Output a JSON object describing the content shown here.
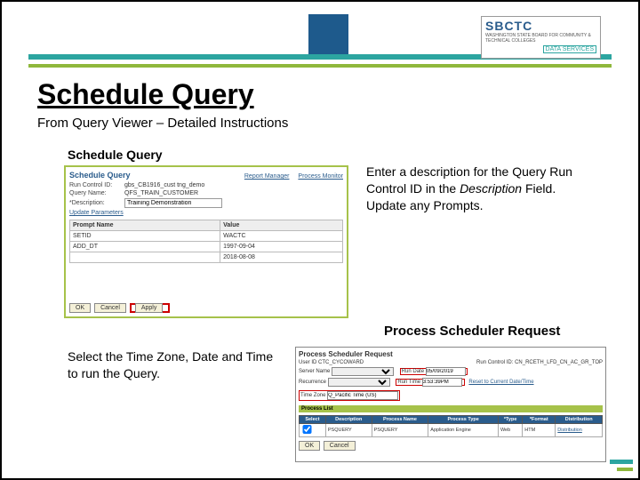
{
  "logo": {
    "name": "SBCTC",
    "sub": "WASHINGTON STATE BOARD FOR COMMUNITY & TECHNICAL COLLEGES",
    "ds": "DATA SERVICES"
  },
  "title": "Schedule Query",
  "subtitle": "From Query Viewer – Detailed Instructions",
  "section1_label": "Schedule Query",
  "sq": {
    "header": "Schedule Query",
    "run_ctrl_lbl": "Run Control ID:",
    "run_ctrl_val": "gbs_CB1916_cust tng_demo",
    "link_report": "Report Manager",
    "link_process": "Process Monitor",
    "qname_lbl": "Query Name:",
    "qname_val": "QFS_TRAIN_CUSTOMER",
    "desc_lbl": "*Description:",
    "desc_val": "Training Demonstration",
    "update_params": "Update Parameters",
    "th_prompt": "Prompt Name",
    "th_value": "Value",
    "rows": [
      {
        "p": "SETID",
        "v": "WACTC"
      },
      {
        "p": "ADD_DT",
        "v": "1997-09-04"
      },
      {
        "p": "",
        "v": "2018-08-08"
      }
    ],
    "btn_ok": "OK",
    "btn_cancel": "Cancel",
    "btn_apply": "Apply"
  },
  "instruction1_a": "Enter a description for the Query Run Control ID in the ",
  "instruction1_i": "Description",
  "instruction1_b": " Field. Update any Prompts.",
  "psr_label": "Process Scheduler Request",
  "instruction2": "Select the Time Zone, Date and Time to run the Query.",
  "psr": {
    "header": "Process Scheduler Request",
    "user_lbl": "User ID",
    "user_val": "CTC_CYCOWARD",
    "rc_lbl": "Run Control ID:",
    "rc_val": "CN_RCETH_LFD_CN_AC_GR_TOP",
    "server_lbl": "Server Name",
    "server_val": "",
    "rundate_lbl": "Run Date",
    "rundate_val": "05/09/2019",
    "recur_lbl": "Recurrence",
    "recur_val": "",
    "runtime_lbl": "Run Time",
    "runtime_val": "3:53:39PM",
    "reset_link": "Reset to Current Date/Time",
    "tz_lbl": "Time Zone",
    "tz_val": "Q_Pacific Time (US)",
    "plist": "Process List",
    "th": {
      "sel": "Select",
      "desc": "Description",
      "pname": "Process Name",
      "ptype": "Process Type",
      "type": "*Type",
      "fmt": "*Format",
      "dist": "Distribution"
    },
    "row": {
      "desc": "PSQUERY",
      "pname": "PSQUERY",
      "ptype": "Application Engine",
      "type": "Web",
      "fmt": "HTM",
      "dist": "Distribution"
    },
    "btn_ok": "OK",
    "btn_cancel": "Cancel"
  }
}
